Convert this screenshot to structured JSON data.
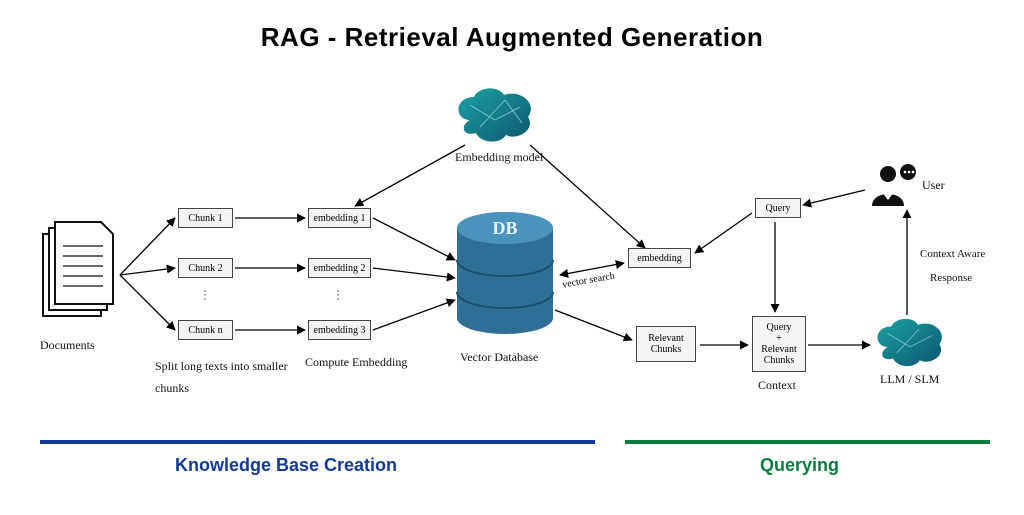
{
  "title": "RAG - Retrieval Augmented Generation",
  "left": {
    "documents_label": "Documents",
    "chunks": [
      "Chunk 1",
      "Chunk 2",
      "Chunk n"
    ],
    "embeddings": [
      "embedding 1",
      "embedding 2",
      "embedding 3"
    ],
    "split_note": "Split long texts into smaller chunks",
    "compute_note": "Compute Embedding",
    "embedding_model_label": "Embedding model",
    "vector_db_label": "Vector Database",
    "db_glyph": "DB"
  },
  "right": {
    "embedding_box": "embedding",
    "vector_search_label": "vector search",
    "relevant_chunks_box": "Relevant Chunks",
    "query_box": "Query",
    "context_box": "Query\n+\nRelevant\nChunks",
    "context_label": "Context",
    "context_aware_line1": "Context Aware",
    "context_aware_line2": "Response",
    "llm_label": "LLM / SLM",
    "user_label": "User"
  },
  "sections": {
    "kb": "Knowledge Base Creation",
    "query": "Querying"
  }
}
